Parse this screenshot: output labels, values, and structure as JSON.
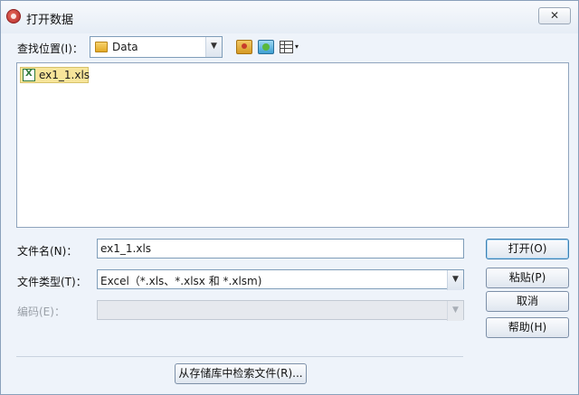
{
  "window": {
    "title": "打开数据",
    "close_glyph": "✕"
  },
  "toolbar": {
    "look_in_label": "查找位置(I)：",
    "location_value": "Data",
    "combo_arrow": "▼",
    "view_arrow": "▾"
  },
  "file_list": {
    "items": [
      {
        "name": "ex1_1.xls",
        "icon": "excel-file-icon",
        "selected": true
      }
    ]
  },
  "form": {
    "file_name_label": "文件名(N)：",
    "file_name_value": "ex1_1.xls",
    "file_type_label": "文件类型(T)：",
    "file_type_value": "Excel（*.xls、*.xlsx 和 *.xlsm)",
    "encoding_label": "编码(E)：",
    "encoding_value": ""
  },
  "buttons": {
    "open": "打开(O)",
    "paste": "粘贴(P)",
    "cancel": "取消",
    "help": "帮助(H)",
    "retrieve": "从存储库中检索文件(R)..."
  },
  "colors": {
    "dialog_background": "#eef3fa",
    "selection_highlight": "#f7e59a",
    "field_border": "#7f9db9"
  }
}
